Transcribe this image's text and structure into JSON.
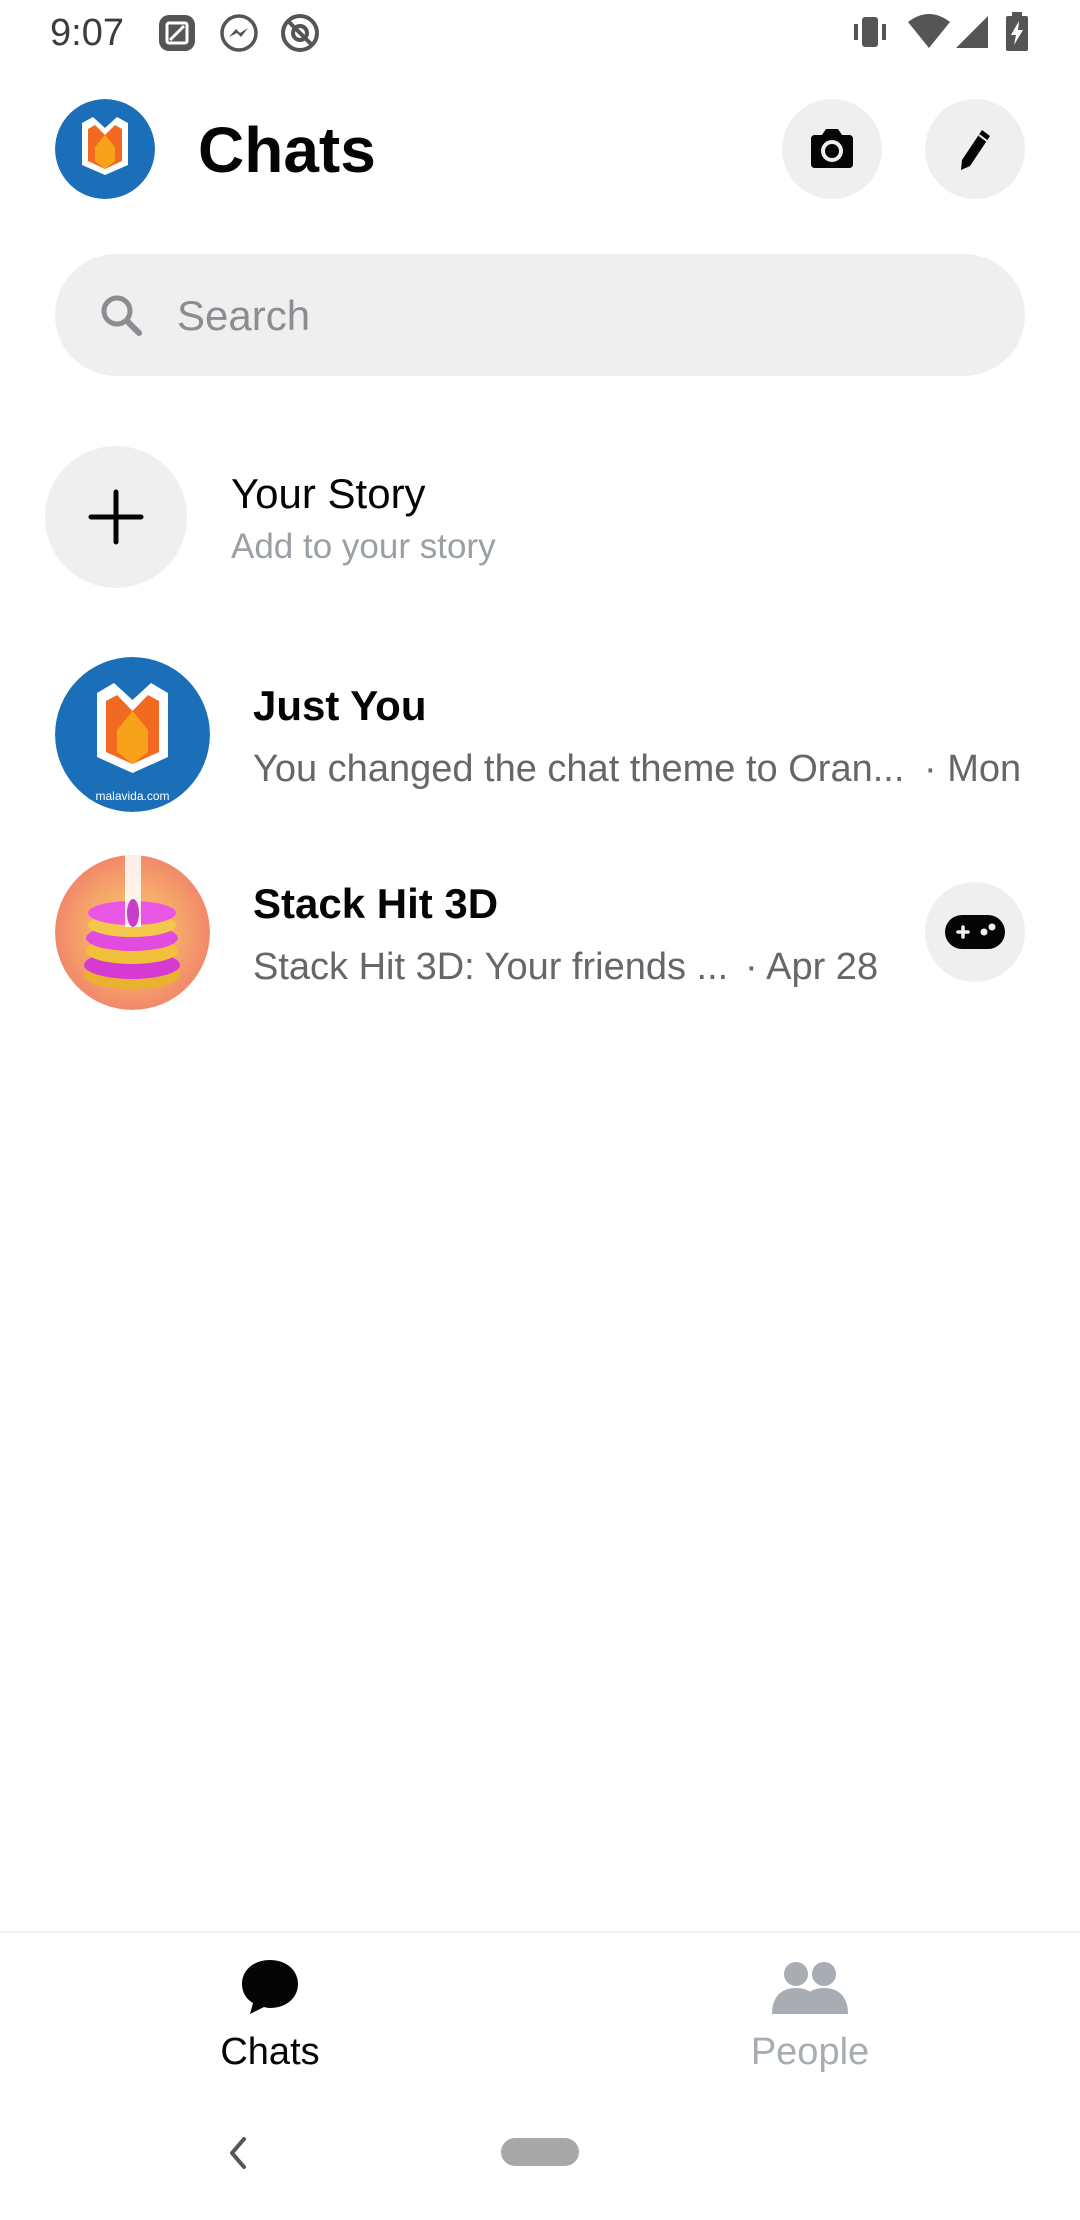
{
  "status_bar": {
    "time": "9:07",
    "left_icons": [
      "screenshot-icon",
      "messenger-notification-icon",
      "do-not-disturb-icon"
    ],
    "right_icons": [
      "vibrate-icon",
      "wifi-icon",
      "signal-icon",
      "battery-charging-icon"
    ]
  },
  "header": {
    "title": "Chats",
    "avatar_text": "malavida.com",
    "camera_icon": "camera-icon",
    "compose_icon": "pencil-icon"
  },
  "search": {
    "placeholder": "Search",
    "value": ""
  },
  "story": {
    "title": "Your Story",
    "subtitle": "Add to your story"
  },
  "chats": [
    {
      "name": "Just You",
      "preview": "You changed the chat theme to Oran...",
      "time": "· Mon",
      "avatar_text": "malavida.com"
    },
    {
      "name": "Stack Hit 3D",
      "preview": "Stack Hit 3D: Your friends ...",
      "time": "· Apr 28",
      "action_icon": "gamepad-icon"
    }
  ],
  "bottom_nav": {
    "items": [
      {
        "label": "Chats",
        "icon": "chat-bubble-icon",
        "active": true
      },
      {
        "label": "People",
        "icon": "people-icon",
        "active": false
      }
    ]
  },
  "colors": {
    "brand_blue": "#1a6fb8",
    "brand_orange": "#f26a21",
    "inactive_gray": "#a8acb3"
  }
}
